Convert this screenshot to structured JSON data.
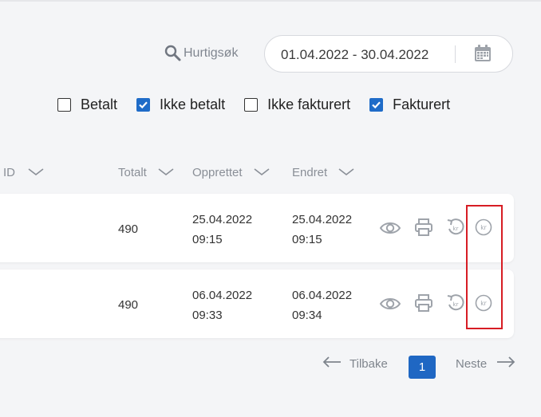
{
  "search": {
    "label": "Hurtigsøk"
  },
  "date_range": {
    "value": "01.04.2022 - 30.04.2022"
  },
  "filters": [
    {
      "label": "Betalt",
      "checked": false
    },
    {
      "label": "Ikke betalt",
      "checked": true
    },
    {
      "label": "Ikke fakturert",
      "checked": false
    },
    {
      "label": "Fakturert",
      "checked": true
    }
  ],
  "columns": {
    "id": "ID",
    "total": "Totalt",
    "created": "Opprettet",
    "changed": "Endret"
  },
  "rows": [
    {
      "total": "490",
      "created_date": "25.04.2022",
      "created_time": "09:15",
      "changed_date": "25.04.2022",
      "changed_time": "09:15"
    },
    {
      "total": "490",
      "created_date": "06.04.2022",
      "created_time": "09:33",
      "changed_date": "06.04.2022",
      "changed_time": "09:34"
    }
  ],
  "pagination": {
    "prev": "Tilbake",
    "current": "1",
    "next": "Neste"
  },
  "colors": {
    "accent": "#1f6cc8",
    "highlight": "#d71d24"
  },
  "icons": {
    "row_actions": [
      "eye-icon",
      "print-icon",
      "refund-icon",
      "kr-payment-icon"
    ]
  }
}
